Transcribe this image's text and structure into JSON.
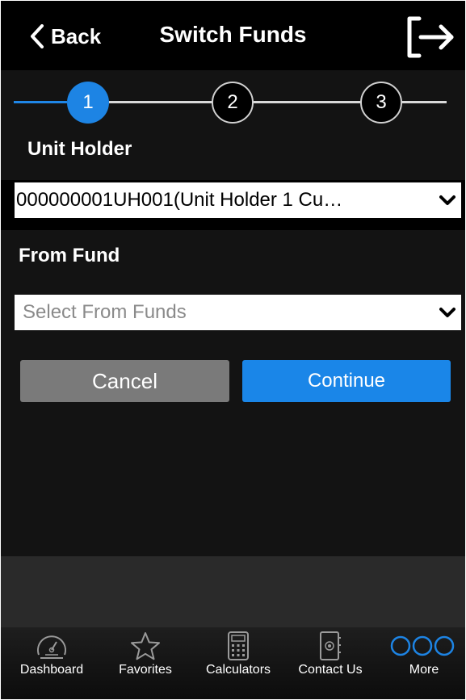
{
  "header": {
    "back_label": "Back",
    "title": "Switch Funds",
    "back_icon": "chevron-left-icon",
    "logout_icon": "logout-icon"
  },
  "stepper": {
    "steps": [
      {
        "label": "1",
        "active": true
      },
      {
        "label": "2",
        "active": false
      },
      {
        "label": "3",
        "active": false
      }
    ]
  },
  "form": {
    "unit_holder_label": "Unit Holder",
    "unit_holder_value": "000000001UH001(Unit Holder 1 Cu…",
    "from_fund_label": "From Fund",
    "from_fund_placeholder": "Select From Funds"
  },
  "actions": {
    "cancel_label": "Cancel",
    "continue_label": "Continue"
  },
  "tabbar": {
    "items": [
      {
        "label": "Dashboard",
        "icon": "speedometer-icon"
      },
      {
        "label": "Favorites",
        "icon": "star-icon"
      },
      {
        "label": "Calculators",
        "icon": "calculator-icon"
      },
      {
        "label": "Contact Us",
        "icon": "contact-book-icon"
      },
      {
        "label": "More",
        "icon": "more-circles-icon"
      }
    ]
  },
  "colors": {
    "accent": "#1d84e4",
    "background": "#131313",
    "header": "#000000",
    "cancel": "#7a7a7a"
  }
}
